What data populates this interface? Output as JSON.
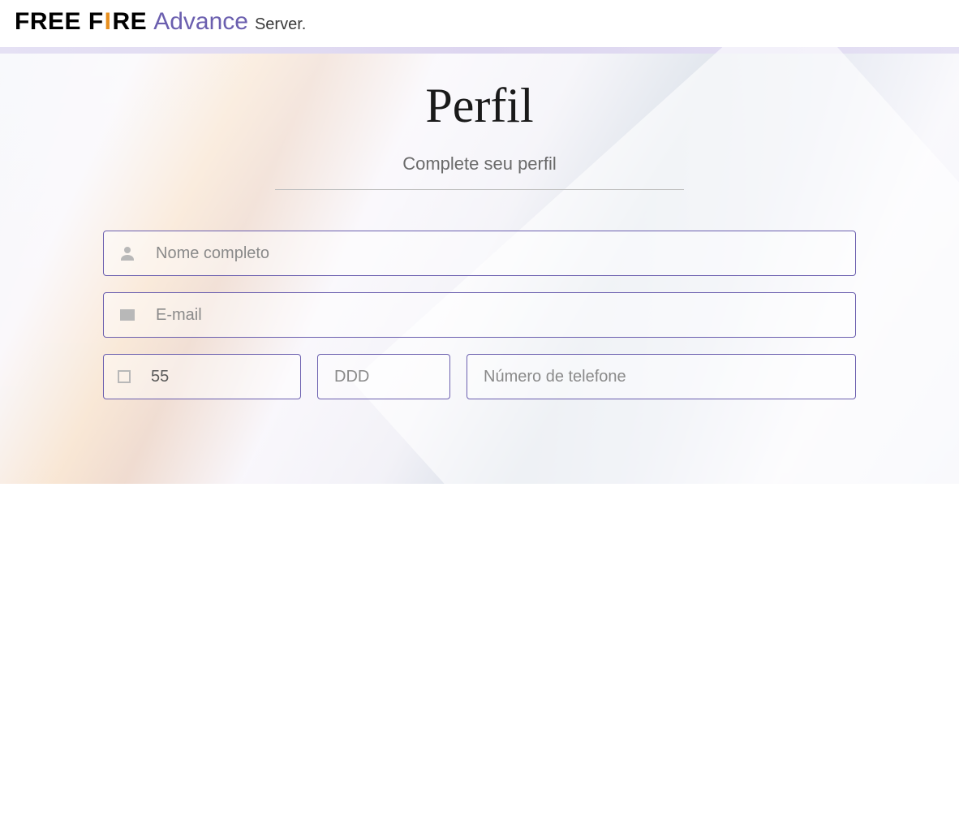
{
  "header": {
    "logo_part1": "FREE F",
    "logo_flame": "I",
    "logo_part2": "RE",
    "logo_advance": "Advance",
    "logo_server": "Server."
  },
  "page": {
    "title": "Perfil",
    "subtitle": "Complete seu perfil"
  },
  "form": {
    "name_placeholder": "Nome completo",
    "email_placeholder": "E-mail",
    "country_code_value": "55",
    "ddd_placeholder": "DDD",
    "phone_placeholder": "Número de telefone"
  }
}
